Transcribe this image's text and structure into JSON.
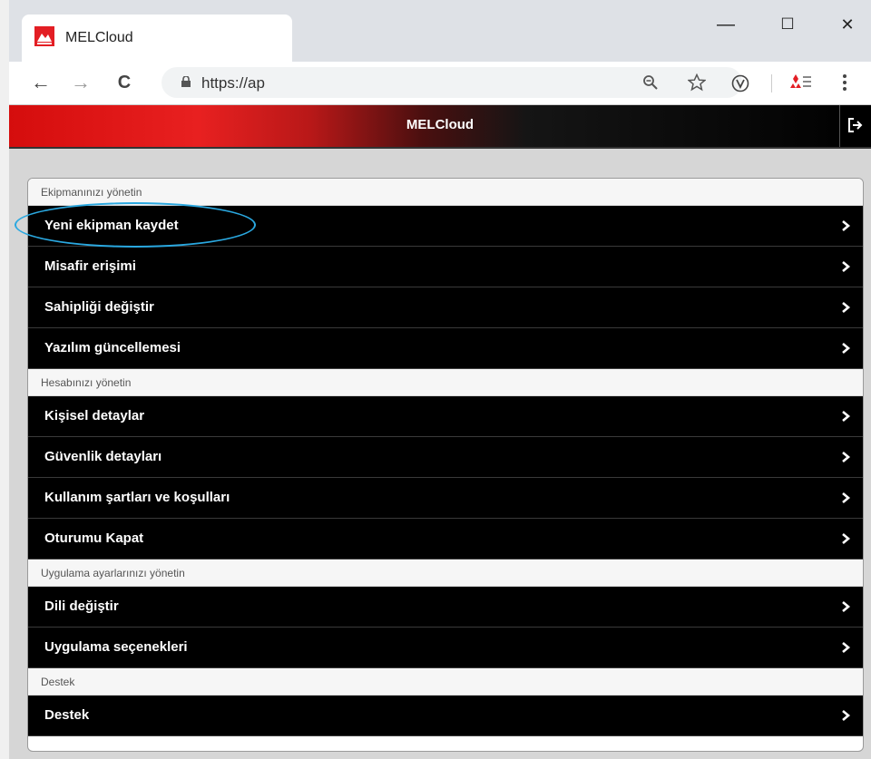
{
  "browser": {
    "tab_title": "MELCloud",
    "url": "https://ap",
    "window_controls": {
      "minimize": "—",
      "maximize": "☐",
      "close": "✕"
    },
    "nav": {
      "back": "←",
      "forward": "→",
      "reload": "C"
    }
  },
  "app": {
    "title": "MELCloud",
    "brand_color": "#e31e24"
  },
  "sections": [
    {
      "header": "Ekipmanınızı yönetin",
      "items": [
        "Yeni ekipman kaydet",
        "Misafir erişimi",
        "Sahipliği değiştir",
        "Yazılım güncellemesi"
      ]
    },
    {
      "header": "Hesabınızı yönetin",
      "items": [
        "Kişisel detaylar",
        "Güvenlik detayları",
        "Kullanım şartları ve koşulları",
        "Oturumu Kapat"
      ]
    },
    {
      "header": "Uygulama ayarlarınızı yönetin",
      "items": [
        "Dili değiştir",
        "Uygulama seçenekleri"
      ]
    },
    {
      "header": "Destek",
      "items": [
        "Destek"
      ]
    }
  ],
  "highlight_color": "#2aa8e0"
}
